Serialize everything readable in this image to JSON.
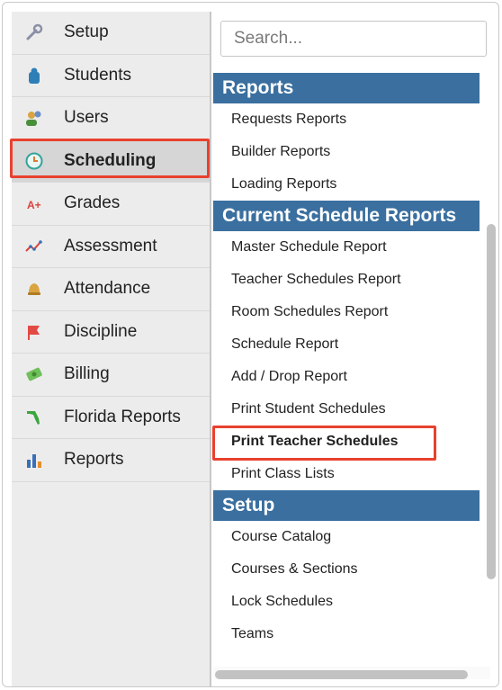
{
  "sidebar": {
    "items": [
      {
        "label": "Setup",
        "icon": "wrench-icon"
      },
      {
        "label": "Students",
        "icon": "student-icon"
      },
      {
        "label": "Users",
        "icon": "users-icon"
      },
      {
        "label": "Scheduling",
        "icon": "clock-icon"
      },
      {
        "label": "Grades",
        "icon": "grades-icon"
      },
      {
        "label": "Assessment",
        "icon": "assessment-icon"
      },
      {
        "label": "Attendance",
        "icon": "bell-icon"
      },
      {
        "label": "Discipline",
        "icon": "flag-icon"
      },
      {
        "label": "Billing",
        "icon": "money-icon"
      },
      {
        "label": "Florida Reports",
        "icon": "florida-icon"
      },
      {
        "label": "Reports",
        "icon": "bar-chart-icon"
      }
    ],
    "active": "Scheduling"
  },
  "search": {
    "placeholder": "Search..."
  },
  "menu": {
    "sections": [
      {
        "title": "Reports",
        "items": [
          "Requests Reports",
          "Builder Reports",
          "Loading Reports"
        ]
      },
      {
        "title": "Current Schedule Reports",
        "items": [
          "Master Schedule Report",
          "Teacher Schedules Report",
          "Room Schedules Report",
          "Schedule Report",
          "Add / Drop Report",
          "Print Student Schedules",
          "Print Teacher Schedules",
          "Print Class Lists"
        ]
      },
      {
        "title": "Setup",
        "items": [
          "Course Catalog",
          "Courses & Sections",
          "Lock Schedules",
          "Teams"
        ]
      }
    ],
    "highlighted_item": "Print Teacher Schedules"
  },
  "colors": {
    "section_header": "#3a6f9f",
    "highlight": "#e8412e",
    "sidebar_bg": "#ececec"
  }
}
